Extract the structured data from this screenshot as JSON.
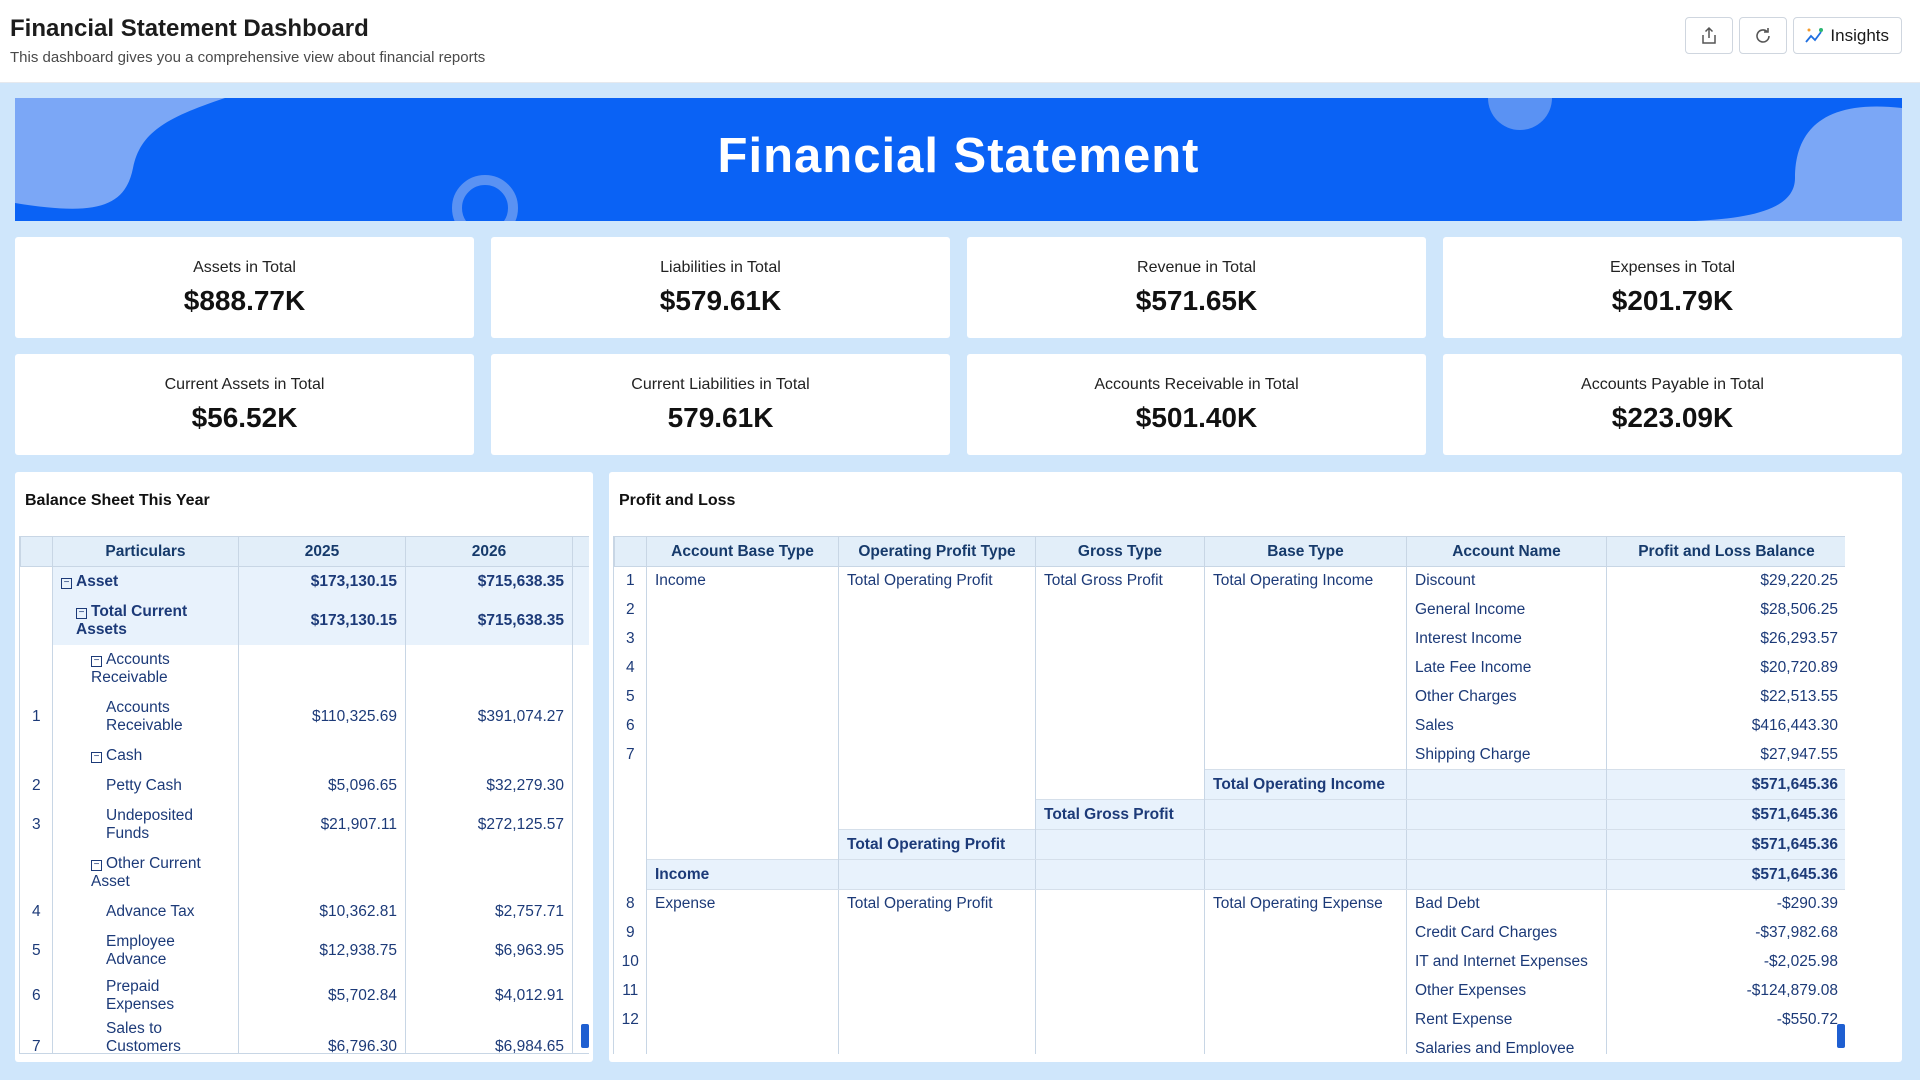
{
  "header": {
    "title": "Financial Statement Dashboard",
    "subtitle": "This dashboard gives you a comprehensive view about financial reports",
    "insights_label": "Insights"
  },
  "banner": {
    "title": "Financial Statement"
  },
  "kpis": [
    {
      "label": "Assets in Total",
      "value": "$888.77K"
    },
    {
      "label": "Liabilities in Total",
      "value": "$579.61K"
    },
    {
      "label": "Revenue in Total",
      "value": "$571.65K"
    },
    {
      "label": "Expenses in Total",
      "value": "$201.79K"
    },
    {
      "label": "Current Assets in Total",
      "value": "$56.52K"
    },
    {
      "label": "Current Liabilities in Total",
      "value": "579.61K"
    },
    {
      "label": "Accounts Receivable in Total",
      "value": "$501.40K"
    },
    {
      "label": "Accounts Payable in Total",
      "value": "$223.09K"
    }
  ],
  "balance_sheet": {
    "title": "Balance Sheet This Year",
    "columns": [
      "Particulars",
      "2025",
      "2026"
    ],
    "rows": [
      {
        "n": "",
        "level": 0,
        "group": true,
        "label": "Asset",
        "v1": "$173,130.15",
        "v2": "$715,638.35"
      },
      {
        "n": "",
        "level": 1,
        "group": true,
        "label": "Total Current Assets",
        "v1": "$173,130.15",
        "v2": "$715,638.35"
      },
      {
        "n": "",
        "level": 2,
        "group": true,
        "plain": true,
        "label": "Accounts Receivable",
        "v1": "",
        "v2": ""
      },
      {
        "n": "1",
        "level": 3,
        "label": "Accounts Receivable",
        "v1": "$110,325.69",
        "v2": "$391,074.27"
      },
      {
        "n": "",
        "level": 2,
        "group": true,
        "plain": true,
        "label": "Cash",
        "v1": "",
        "v2": ""
      },
      {
        "n": "2",
        "level": 3,
        "label": "Petty Cash",
        "v1": "$5,096.65",
        "v2": "$32,279.30"
      },
      {
        "n": "3",
        "level": 3,
        "label": "Undeposited Funds",
        "v1": "$21,907.11",
        "v2": "$272,125.57"
      },
      {
        "n": "",
        "level": 2,
        "group": true,
        "plain": true,
        "label": "Other Current Asset",
        "v1": "",
        "v2": ""
      },
      {
        "n": "4",
        "level": 3,
        "label": "Advance Tax",
        "v1": "$10,362.81",
        "v2": "$2,757.71"
      },
      {
        "n": "5",
        "level": 3,
        "label": "Employee Advance",
        "v1": "$12,938.75",
        "v2": "$6,963.95"
      },
      {
        "n": "6",
        "level": 3,
        "label": "Prepaid Expenses",
        "v1": "$5,702.84",
        "v2": "$4,012.91"
      },
      {
        "n": "7",
        "level": 3,
        "label": "Sales to Customers (Cash)",
        "v1": "$6,796.30",
        "v2": "$6,984.65"
      }
    ]
  },
  "profit_loss": {
    "title": "Profit and Loss",
    "columns": [
      "Account Base Type",
      "Operating Profit Type",
      "Gross Type",
      "Base Type",
      "Account Name",
      "Profit and Loss Balance"
    ],
    "rows": [
      {
        "n": "1",
        "c": [
          "Income",
          "Total Operating Profit",
          "Total Gross Profit",
          "Total Operating Income",
          "Discount",
          "$29,220.25"
        ]
      },
      {
        "n": "2",
        "c": [
          "",
          "",
          "",
          "",
          "General Income",
          "$28,506.25"
        ]
      },
      {
        "n": "3",
        "c": [
          "",
          "",
          "",
          "",
          "Interest Income",
          "$26,293.57"
        ]
      },
      {
        "n": "4",
        "c": [
          "",
          "",
          "",
          "",
          "Late Fee Income",
          "$20,720.89"
        ]
      },
      {
        "n": "5",
        "c": [
          "",
          "",
          "",
          "",
          "Other Charges",
          "$22,513.55"
        ]
      },
      {
        "n": "6",
        "c": [
          "",
          "",
          "",
          "",
          "Sales",
          "$416,443.30"
        ]
      },
      {
        "n": "7",
        "c": [
          "",
          "",
          "",
          "",
          "Shipping Charge",
          "$27,947.55"
        ]
      },
      {
        "n": "",
        "sub": 3,
        "c": [
          "",
          "",
          "",
          "Total Operating Income",
          "",
          "$571,645.36"
        ]
      },
      {
        "n": "",
        "sub": 2,
        "c": [
          "",
          "",
          "Total Gross Profit",
          "",
          "",
          "$571,645.36"
        ]
      },
      {
        "n": "",
        "sub": 1,
        "c": [
          "",
          "Total Operating Profit",
          "",
          "",
          "",
          "$571,645.36"
        ]
      },
      {
        "n": "",
        "sub": 0,
        "c": [
          "Income",
          "",
          "",
          "",
          "",
          "$571,645.36"
        ]
      },
      {
        "n": "8",
        "c": [
          "Expense",
          "Total Operating Profit",
          "",
          "Total Operating Expense",
          "Bad Debt",
          "-$290.39"
        ]
      },
      {
        "n": "9",
        "c": [
          "",
          "",
          "",
          "",
          "Credit Card Charges",
          "-$37,982.68"
        ]
      },
      {
        "n": "10",
        "c": [
          "",
          "",
          "",
          "",
          "IT and Internet Expenses",
          "-$2,025.98"
        ]
      },
      {
        "n": "11",
        "c": [
          "",
          "",
          "",
          "",
          "Other Expenses",
          "-$124,879.08"
        ]
      },
      {
        "n": "12",
        "c": [
          "",
          "",
          "",
          "",
          "Rent Expense",
          "-$550.72"
        ]
      },
      {
        "n": "",
        "c": [
          "",
          "",
          "",
          "",
          "Salaries and Employee",
          ""
        ]
      }
    ]
  },
  "colors": {
    "banner": "#0a62f5",
    "canvas": "#cfe6fb",
    "header_cell": "#e2eef9",
    "text_link": "#1c3a78"
  }
}
